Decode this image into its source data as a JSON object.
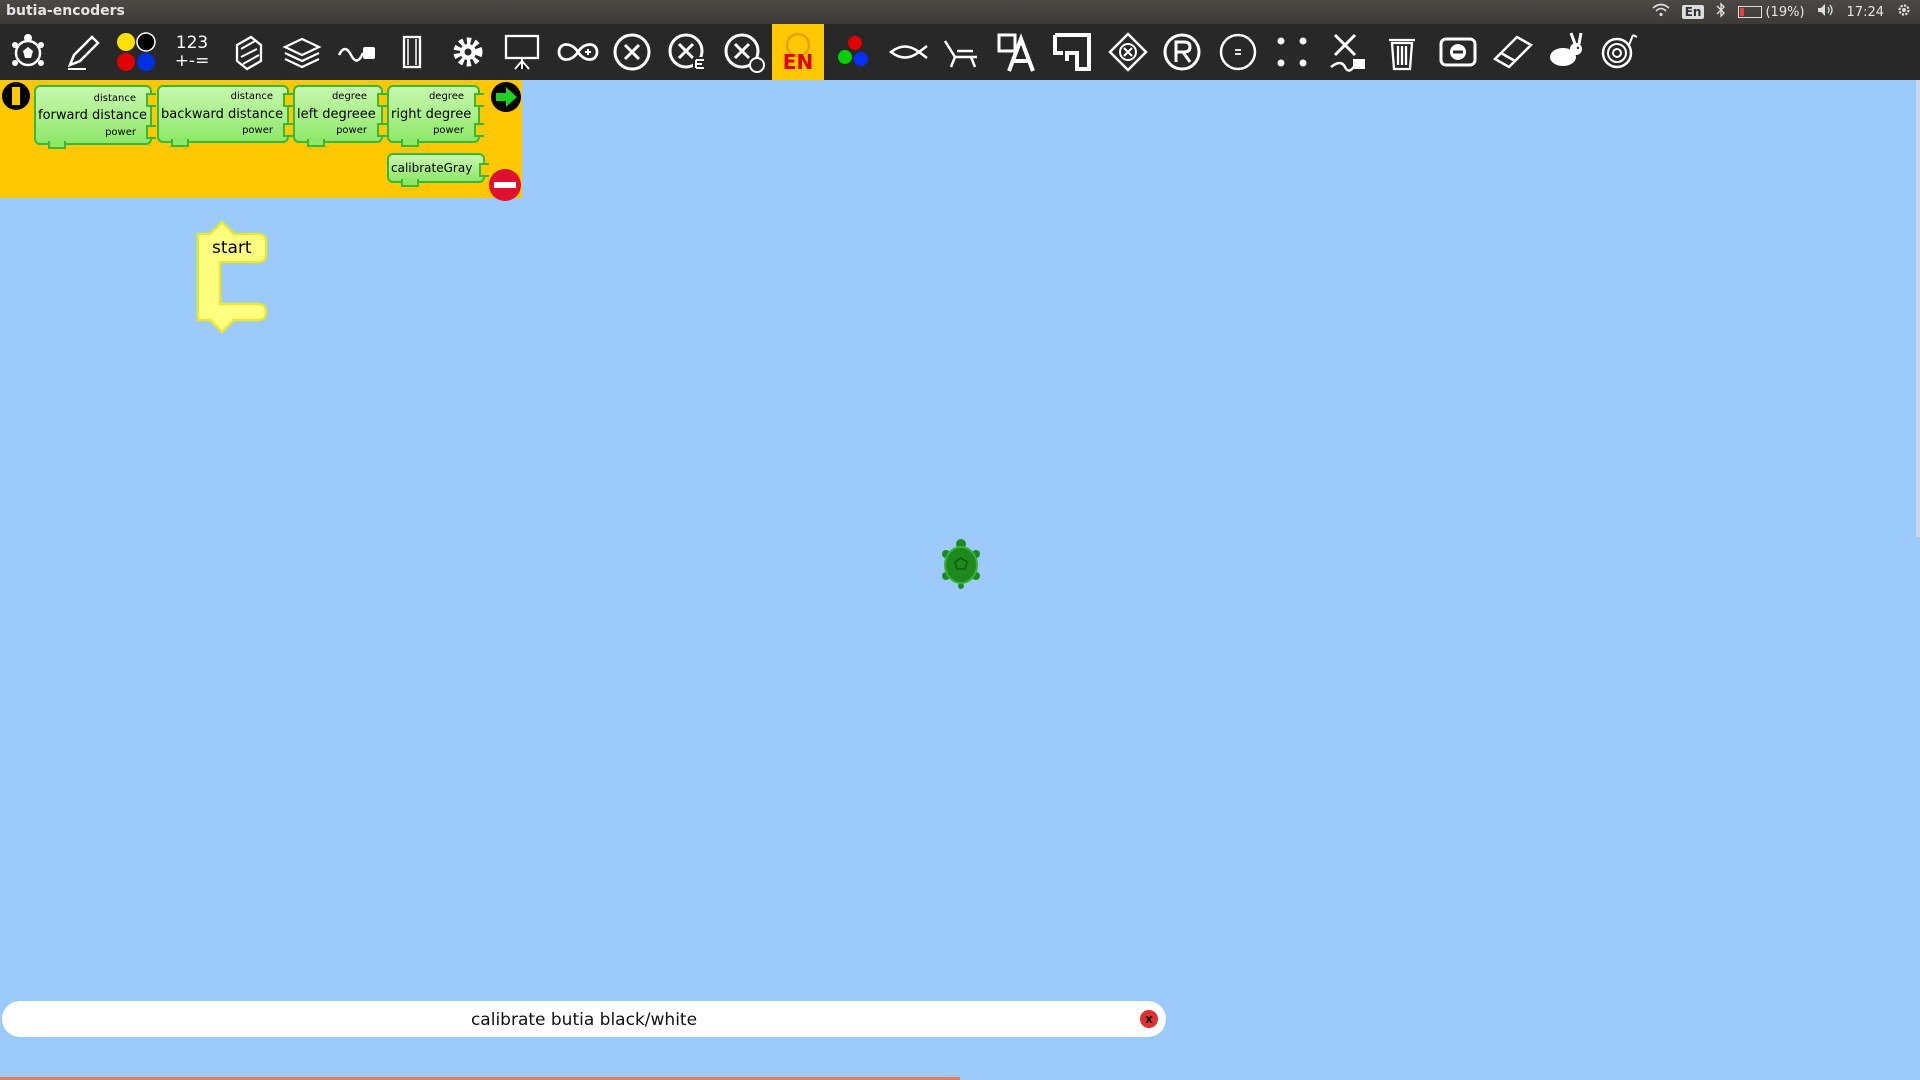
{
  "window": {
    "title": "butia-encoders"
  },
  "tray": {
    "keyboard": "En",
    "battery": "(19%)",
    "battery_level": 0.19,
    "time": "17:24"
  },
  "toolbar": {
    "numbers_label_top": "123",
    "numbers_label_bottom": "+-=",
    "language_label": "EN"
  },
  "palette": {
    "blocks": [
      {
        "label": "forward distance",
        "arg_top": "distance",
        "arg_bottom": "power"
      },
      {
        "label": "backward distance",
        "arg_top": "distance",
        "arg_bottom": "power"
      },
      {
        "label": "left degreee",
        "arg_top": "degree",
        "arg_bottom": "power"
      },
      {
        "label": "right degree",
        "arg_top": "degree",
        "arg_bottom": "power"
      },
      {
        "label": "calibrateGray"
      }
    ]
  },
  "canvas": {
    "start_block": "start"
  },
  "status": {
    "message": "calibrate butia black/white",
    "close": "x"
  },
  "colors": {
    "canvas_bg": "#9ccbfb",
    "palette_bg": "#ffc800",
    "block_fill": "#8ee868",
    "start_block": "#ffff80",
    "turtle": "#1e8a1e"
  }
}
